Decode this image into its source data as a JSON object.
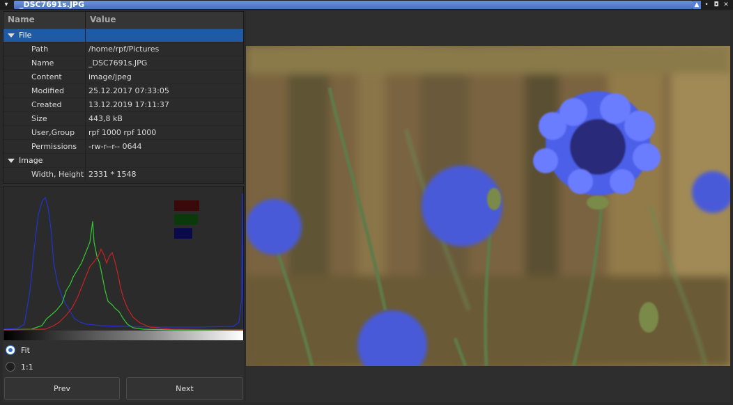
{
  "window": {
    "title": "_DSC7691s.JPG",
    "controls": [
      "up",
      "dot",
      "restore",
      "close"
    ]
  },
  "tree": {
    "headers": {
      "name": "Name",
      "value": "Value"
    },
    "groups": [
      {
        "label": "File",
        "expanded": true,
        "selected": true,
        "rows": [
          {
            "key": "Path",
            "value": "/home/rpf/Pictures"
          },
          {
            "key": "Name",
            "value": "_DSC7691s.JPG"
          },
          {
            "key": "Content",
            "value": "image/jpeg"
          },
          {
            "key": "Modified",
            "value": "25.12.2017 07:33:05"
          },
          {
            "key": "Created",
            "value": "13.12.2019 17:11:37"
          },
          {
            "key": "Size",
            "value": "443,8 kB"
          },
          {
            "key": "User,Group",
            "value": "rpf 1000 rpf 1000"
          },
          {
            "key": "Permissions",
            "value": "-rw-r--r-- 0644"
          }
        ]
      },
      {
        "label": "Image",
        "expanded": true,
        "selected": false,
        "rows": [
          {
            "key": "Width, Height",
            "value": "2331 * 1548"
          }
        ]
      }
    ]
  },
  "histogram": {
    "colors": {
      "red": "#cc2222",
      "green": "#33cc33",
      "blue": "#2233cc"
    },
    "swatches": {
      "red": "#3a0a0a",
      "green": "#0a3a0a",
      "blue": "#0a0a4a"
    }
  },
  "zoom": {
    "options": [
      {
        "label": "Fit",
        "checked": true
      },
      {
        "label": "1:1",
        "checked": false
      }
    ]
  },
  "buttons": {
    "prev": "Prev",
    "next": "Next"
  },
  "colors": {
    "selection": "#1f5aa5",
    "title_accent": "#5b7fd0"
  }
}
